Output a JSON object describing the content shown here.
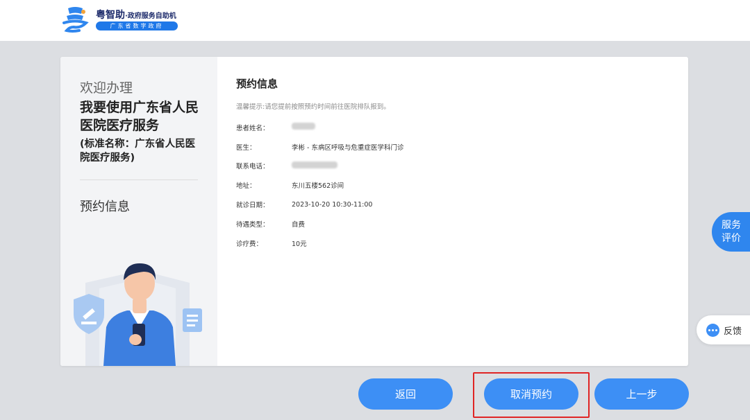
{
  "header": {
    "logo_icon": "yue-logo-icon",
    "brand_name": "粤智助",
    "brand_sub": "·政府服务自助机",
    "brand_org": "广东省数字政府"
  },
  "left_panel": {
    "welcome": "欢迎办理",
    "service_title": "我要使用广东省人民医院医疗服务",
    "standard_name": "(标准名称：广东省人民医院医疗服务)",
    "current_step": "预约信息",
    "illustration_icons": [
      "person-illustration",
      "shield-gavel-icon",
      "document-icon",
      "phone-icon"
    ]
  },
  "main": {
    "title": "预约信息",
    "hint": "温馨提示:请您提前按照预约时间前往医院排队报到。",
    "fields": [
      {
        "label": "患者姓名：",
        "value": "",
        "blurred": true
      },
      {
        "label": "医生：",
        "value": "李彬 - 东病区呼吸与危重症医学科门诊"
      },
      {
        "label": "联系电话：",
        "value": "",
        "blurred": true
      },
      {
        "label": "地址：",
        "value": "东川五楼562诊间"
      },
      {
        "label": "就诊日期：",
        "value": "2023-10-20 10:30-11:00"
      },
      {
        "label": "待遇类型：",
        "value": "自费"
      },
      {
        "label": "诊疗费：",
        "value": "10元"
      }
    ]
  },
  "side_buttons": {
    "evaluate_line1": "服务",
    "evaluate_line2": "评价",
    "feedback_icon": "chat-bubble-icon",
    "feedback": "反馈"
  },
  "buttons": {
    "back": "返回",
    "cancel": "取消预约",
    "prev": "上一步"
  },
  "colors": {
    "primary": "#3d8ff5",
    "highlight": "#e02424",
    "brand_dark": "#1d2b6b"
  }
}
